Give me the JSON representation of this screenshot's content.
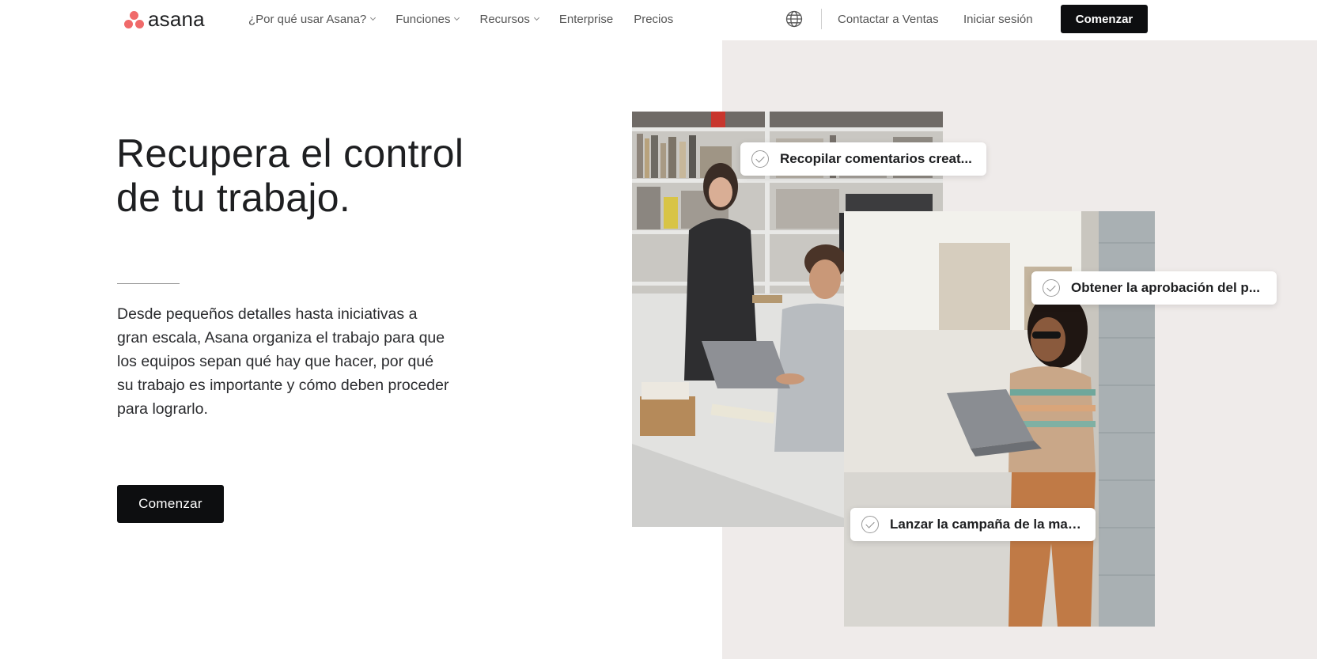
{
  "brand": {
    "name": "asana",
    "logo_color": "#f06a6a"
  },
  "nav": {
    "items": [
      {
        "label": "¿Por qué usar Asana?",
        "has_dropdown": true
      },
      {
        "label": "Funciones",
        "has_dropdown": true
      },
      {
        "label": "Recursos",
        "has_dropdown": true
      },
      {
        "label": "Enterprise",
        "has_dropdown": false
      },
      {
        "label": "Precios",
        "has_dropdown": false
      }
    ],
    "language_icon": "globe-icon",
    "contact_sales": "Contactar a Ventas",
    "login": "Iniciar sesión",
    "cta": "Comenzar"
  },
  "hero": {
    "title_line1": "Recupera el control",
    "title_line2": "de tu trabajo.",
    "description": "Desde pequeños detalles hasta iniciativas a gran escala, Asana organiza el trabajo para que los equipos sepan qué hay que hacer, por qué su trabajo es importante y cómo deben proceder para lograrlo.",
    "cta": "Comenzar"
  },
  "tasks": [
    {
      "label": "Recopilar comentarios creat...",
      "icon": "check-circle-icon"
    },
    {
      "label": "Obtener la aprobación del p...",
      "icon": "check-circle-icon"
    },
    {
      "label": "Lanzar la campaña de la mar...",
      "icon": "check-circle-icon"
    }
  ],
  "colors": {
    "primary_button": "#0d0e10",
    "panel_background": "#efebea",
    "text": "#1e1f21"
  }
}
